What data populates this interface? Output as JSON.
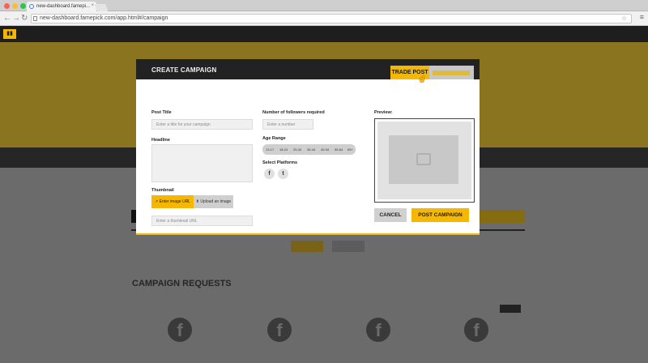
{
  "browser": {
    "tab_title": "new-dashboard.famepi...",
    "tab_close": "×",
    "url": "new-dashboard.famepick.com/app.html#/campaign",
    "back": "←",
    "forward": "→",
    "reload": "↻",
    "bookmark": "☆",
    "menu": "≡",
    "traffic": [
      "#ff5f57",
      "#febc2e",
      "#28c840"
    ]
  },
  "modal": {
    "title": "CREATE CAMPAIGN",
    "tabs": {
      "trade_post": "TRADE POST"
    },
    "post_title": {
      "label": "Post Title",
      "placeholder": "Enter a title for your campaign"
    },
    "headline": {
      "label": "Headline"
    },
    "thumbnail": {
      "label": "Thumbnail",
      "enter_url": "Enter image URL",
      "upload": "Upload an image",
      "placeholder": "Enter a thumbnail URL"
    },
    "followers": {
      "label": "Number of followers required",
      "placeholder": "Enter a number"
    },
    "age_range": {
      "label": "Age Range",
      "options": [
        "13-17",
        "18-24",
        "25-34",
        "35-44",
        "45-54",
        "55-64",
        "65+"
      ]
    },
    "platforms": {
      "label": "Select Platforms",
      "facebook": "f",
      "twitter": "t"
    },
    "preview": {
      "label": "Preview:"
    },
    "cancel": "CANCEL",
    "post": "POST CAMPAIGN"
  },
  "background": {
    "section_title": "CAMPAIGN REQUESTS",
    "fb_glyph": "f"
  },
  "colors": {
    "accent": "#f5b700",
    "dark": "#222222"
  }
}
